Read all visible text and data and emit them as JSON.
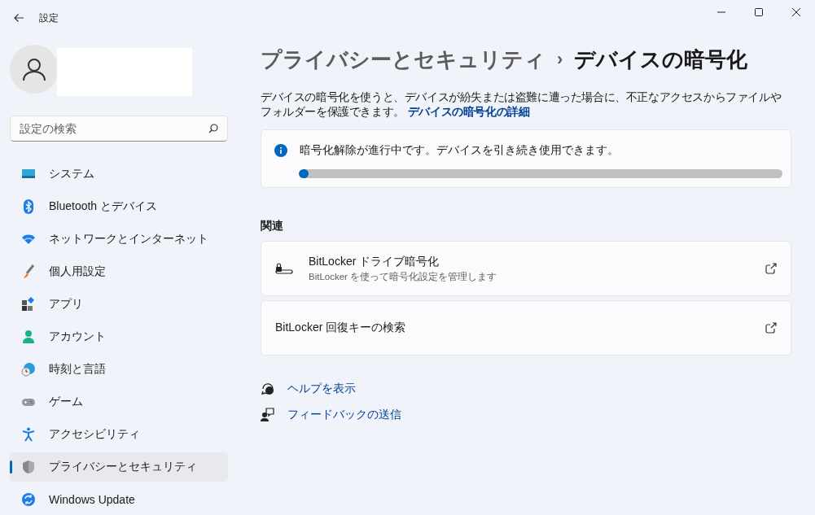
{
  "window": {
    "title": "設定"
  },
  "search": {
    "placeholder": "設定の検索"
  },
  "nav": [
    {
      "label": "システム",
      "selected": false
    },
    {
      "label": "Bluetooth とデバイス",
      "selected": false
    },
    {
      "label": "ネットワークとインターネット",
      "selected": false
    },
    {
      "label": "個人用設定",
      "selected": false
    },
    {
      "label": "アプリ",
      "selected": false
    },
    {
      "label": "アカウント",
      "selected": false
    },
    {
      "label": "時刻と言語",
      "selected": false
    },
    {
      "label": "ゲーム",
      "selected": false
    },
    {
      "label": "アクセシビリティ",
      "selected": false
    },
    {
      "label": "プライバシーとセキュリティ",
      "selected": true
    },
    {
      "label": "Windows Update",
      "selected": false
    }
  ],
  "breadcrumb": {
    "parent": "プライバシーとセキュリティ",
    "separator": "›",
    "current": "デバイスの暗号化"
  },
  "description": {
    "text": "デバイスの暗号化を使うと、デバイスが紛失または盗難に遭った場合に、不正なアクセスからファイルやフォルダーを保護できます。",
    "link": "デバイスの暗号化の詳細"
  },
  "status": {
    "message": "暗号化解除が進行中です。デバイスを引き続き使用できます。",
    "level": 0.02
  },
  "related": {
    "heading": "関連",
    "items": [
      {
        "title": "BitLocker ドライブ暗号化",
        "subtitle": "BitLocker を使って暗号化設定を管理します"
      },
      {
        "title": "BitLocker 回復キーの検索"
      }
    ]
  },
  "links": [
    {
      "label": "ヘルプを表示"
    },
    {
      "label": "フィードバックの送信"
    }
  ]
}
